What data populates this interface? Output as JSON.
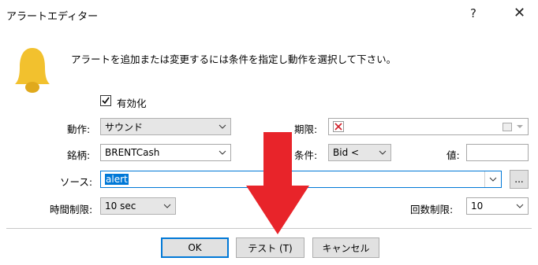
{
  "window": {
    "title": "アラートエディター",
    "help_label": "?",
    "close_label": "✕"
  },
  "description": "アラートを追加または変更するには条件を指定し動作を選択して下さい。",
  "enable": {
    "label": "有効化",
    "checked": true
  },
  "action": {
    "label": "動作:",
    "value": "サウンド"
  },
  "expiry": {
    "label": "期限:"
  },
  "symbol": {
    "label": "銘柄:",
    "value": "BRENTCash"
  },
  "condition": {
    "label": "条件:",
    "value": "Bid <"
  },
  "value_field": {
    "label": "値:",
    "value": ""
  },
  "source": {
    "label": "ソース:",
    "value": "alert",
    "browse_label": "..."
  },
  "timeout": {
    "label": "時間制限:",
    "value": "10 sec"
  },
  "repeat": {
    "label": "回数制限:",
    "value": "10"
  },
  "buttons": {
    "ok": "OK",
    "test": "テスト (T)",
    "cancel": "キャンセル"
  },
  "colors": {
    "arrow": "#e8242a",
    "bell": "#f2c12e",
    "accent": "#0078d7"
  }
}
